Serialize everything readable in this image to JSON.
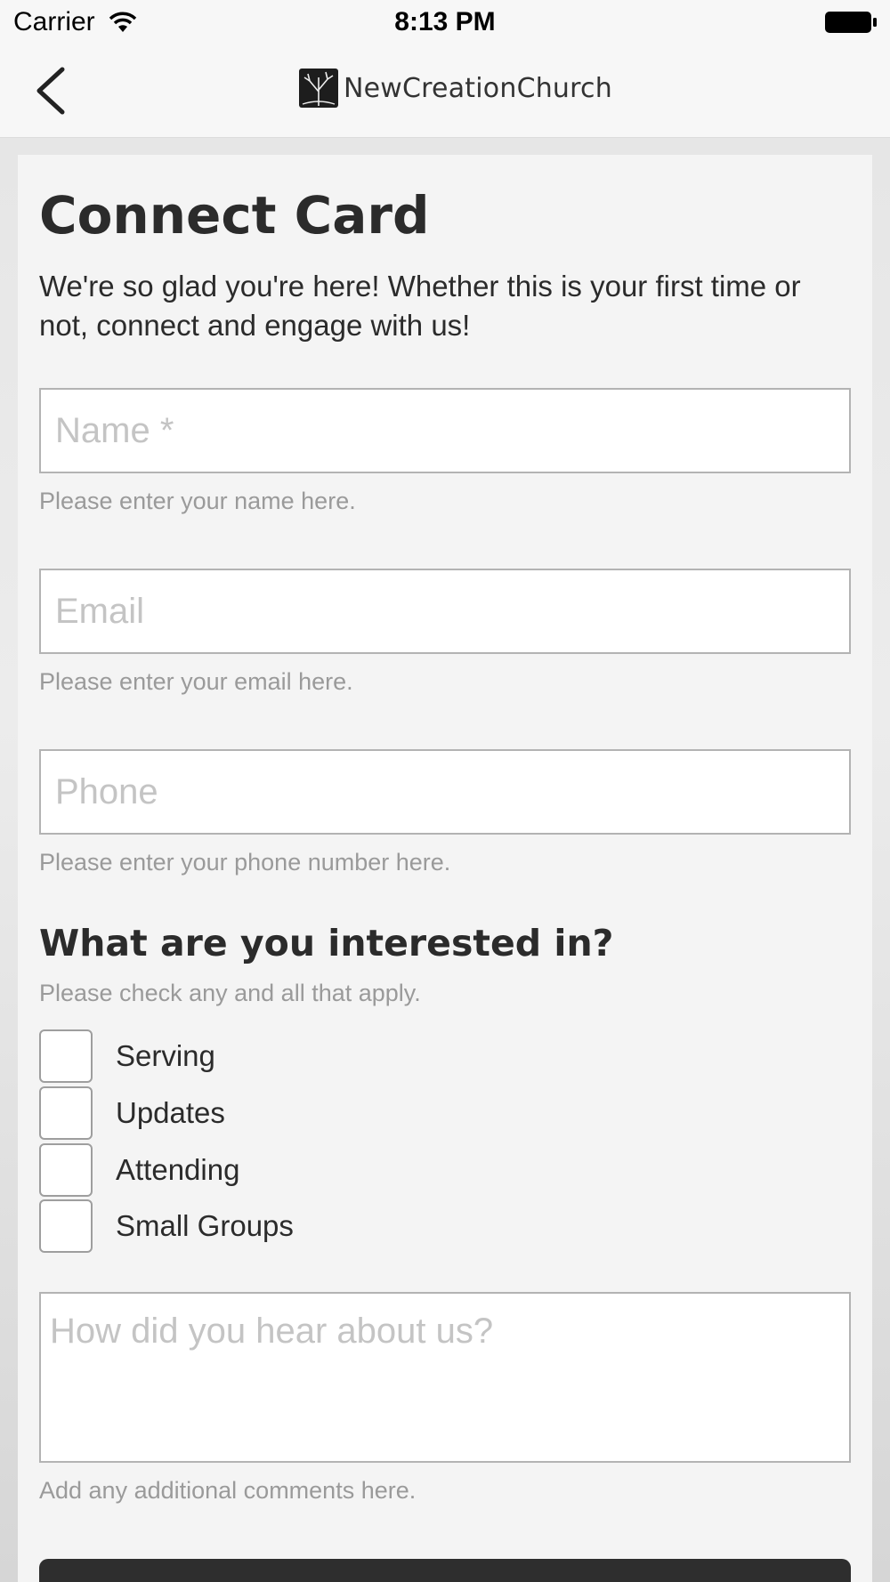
{
  "status_bar": {
    "carrier": "Carrier",
    "time": "8:13 PM"
  },
  "nav": {
    "logo_text": "NewCreationChurch"
  },
  "page": {
    "title": "Connect Card",
    "intro": "We're so glad you're here! Whether this is your first time or not, connect and engage with us!"
  },
  "fields": {
    "name": {
      "placeholder": "Name *",
      "help": "Please enter your name here."
    },
    "email": {
      "placeholder": "Email",
      "help": "Please enter your email here."
    },
    "phone": {
      "placeholder": "Phone",
      "help": "Please enter your phone number here."
    }
  },
  "interests": {
    "title": "What are you interested in?",
    "help": "Please check any and all that apply.",
    "options": [
      "Serving",
      "Updates",
      "Attending",
      "Small Groups"
    ]
  },
  "comments": {
    "placeholder": "How did you hear about us?",
    "help": "Add any additional comments here."
  },
  "icons": {
    "back": "chevron-left-icon",
    "wifi": "wifi-icon",
    "battery": "battery-icon",
    "logo": "church-logo-icon"
  },
  "colors": {
    "accent": "#2e2e2e",
    "background": "#f4f4f4",
    "border": "#b3b3b3",
    "help_text": "#9a9a9a"
  }
}
